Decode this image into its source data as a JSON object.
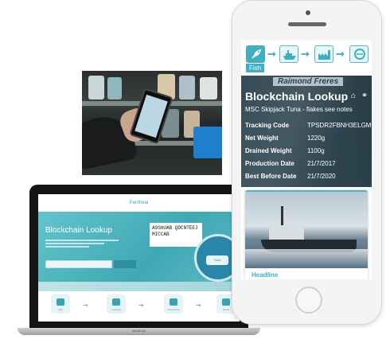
{
  "phone_app": {
    "flow_steps": [
      {
        "icon": "fish-icon"
      },
      {
        "icon": "ship-icon"
      },
      {
        "icon": "factory-icon"
      },
      {
        "icon": "can-icon"
      }
    ],
    "active_step_label": "Fish",
    "background_brand_text": "Raimond Freres",
    "title": "Blockchain Lookup",
    "product_name": "MSC Skipjack Tuna - flakes see notes",
    "fields": [
      {
        "label": "Tracking Code",
        "value": "TPSDR2FBNH3ELGM"
      },
      {
        "label": "Net Weight",
        "value": "1220g"
      },
      {
        "label": "Drained Weight",
        "value": "1100g"
      },
      {
        "label": "Production Date",
        "value": "21/7/2017"
      },
      {
        "label": "Best Before Date",
        "value": "21/7/2020"
      }
    ],
    "card_headline": "Headline",
    "accent_color": "#3fb0c2"
  },
  "laptop_site": {
    "header_title": "Pantheal",
    "hero_title": "Blockchain Lookup",
    "qr_code_text": "A9SHUAB QDCNTEEJ MICCAB",
    "can_label": "Tuna",
    "search_placeholder": "",
    "search_button": "",
    "steps": [
      {
        "label": "Fish"
      },
      {
        "label": "Catching"
      },
      {
        "label": "Processing"
      },
      {
        "label": "Retail"
      }
    ],
    "device_brand": "MacBook"
  }
}
